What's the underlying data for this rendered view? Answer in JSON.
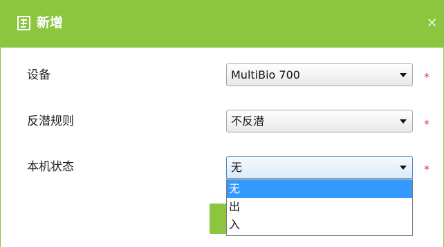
{
  "dialog": {
    "title": "新增",
    "close_glyph": "×"
  },
  "form": {
    "device": {
      "label": "设备",
      "value": "MultiBio 700",
      "required_mark": "*"
    },
    "antipassback": {
      "label": "反潜规则",
      "value": "不反潜",
      "required_mark": "*"
    },
    "machine_state": {
      "label": "本机状态",
      "value": "无",
      "required_mark": "*"
    }
  },
  "dropdown": {
    "options": [
      "无",
      "出",
      "入"
    ],
    "selected_index": 0
  },
  "colors": {
    "accent": "#8cc63e",
    "required": "#e23b3b",
    "selection": "#3399ff"
  },
  "icons": {
    "title": "add-form-icon",
    "dropdown": "chevron-down-icon"
  }
}
